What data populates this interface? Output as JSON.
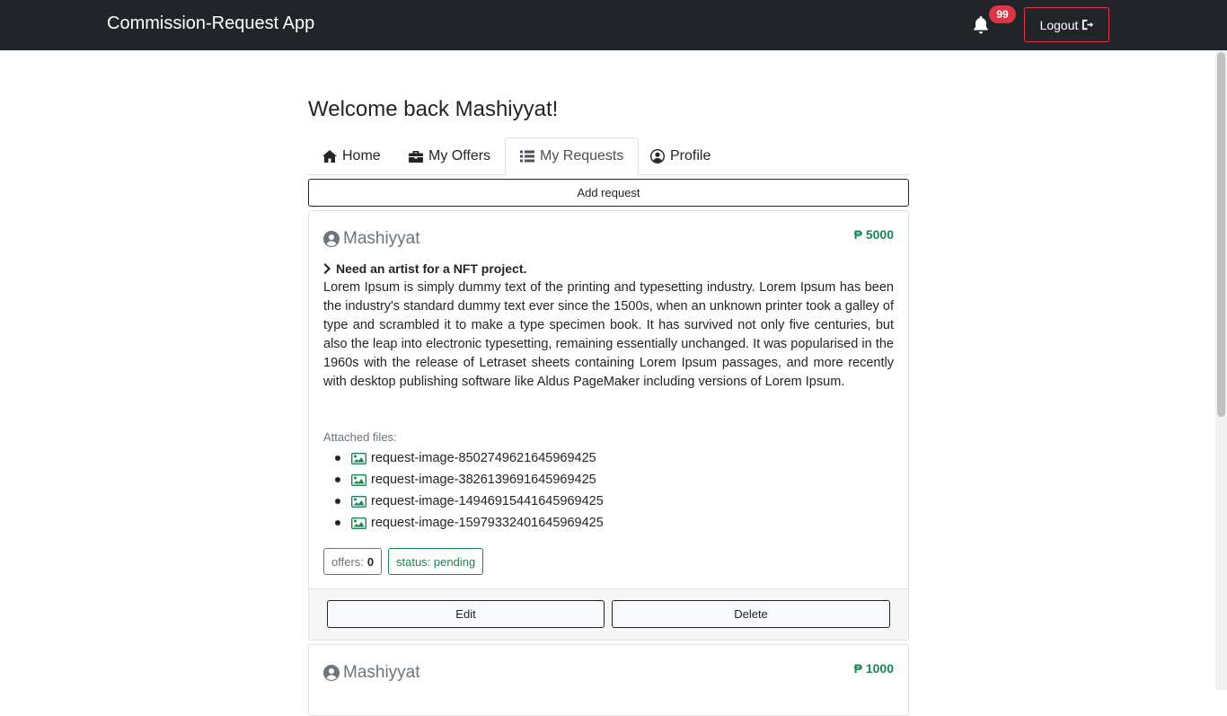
{
  "navbar": {
    "brand": "Commission-Request App",
    "notifications_count": "99",
    "logout_label": "Logout"
  },
  "welcome": "Welcome back Mashiyyat!",
  "tabs": [
    {
      "label": "Home",
      "icon": "home-icon"
    },
    {
      "label": "My Offers",
      "icon": "briefcase-icon"
    },
    {
      "label": "My Requests",
      "icon": "list-icon",
      "active": true
    },
    {
      "label": "Profile",
      "icon": "user-circle-icon"
    }
  ],
  "add_request_label": "Add request",
  "requests": [
    {
      "user": "Mashiyyat",
      "price": "₱ 5000",
      "title": "Need an artist for a NFT project.",
      "description": "Lorem Ipsum is simply dummy text of the printing and typesetting industry. Lorem Ipsum has been the industry's standard dummy text ever since the 1500s, when an unknown printer took a galley of type and scrambled it to make a type specimen book. It has survived not only five centuries, but also the leap into electronic typesetting, remaining essentially unchanged. It was popularised in the 1960s with the release of Letraset sheets containing Lorem Ipsum passages, and more recently with desktop publishing software like Aldus PageMaker including versions of Lorem Ipsum.",
      "attached_label": "Attached files:",
      "files": [
        "request-image-8502749621645969425",
        "request-image-3826139691645969425",
        "request-image-14946915441645969425",
        "request-image-15979332401645969425"
      ],
      "offers_label": "offers:",
      "offers_count": "0",
      "status": "status: pending",
      "edit_label": "Edit",
      "delete_label": "Delete"
    },
    {
      "user": "Mashiyyat",
      "price": "₱ 1000"
    }
  ],
  "colors": {
    "navbar_bg": "#212529",
    "danger": "#dc3545",
    "success": "#198754",
    "muted": "#6c757d"
  }
}
